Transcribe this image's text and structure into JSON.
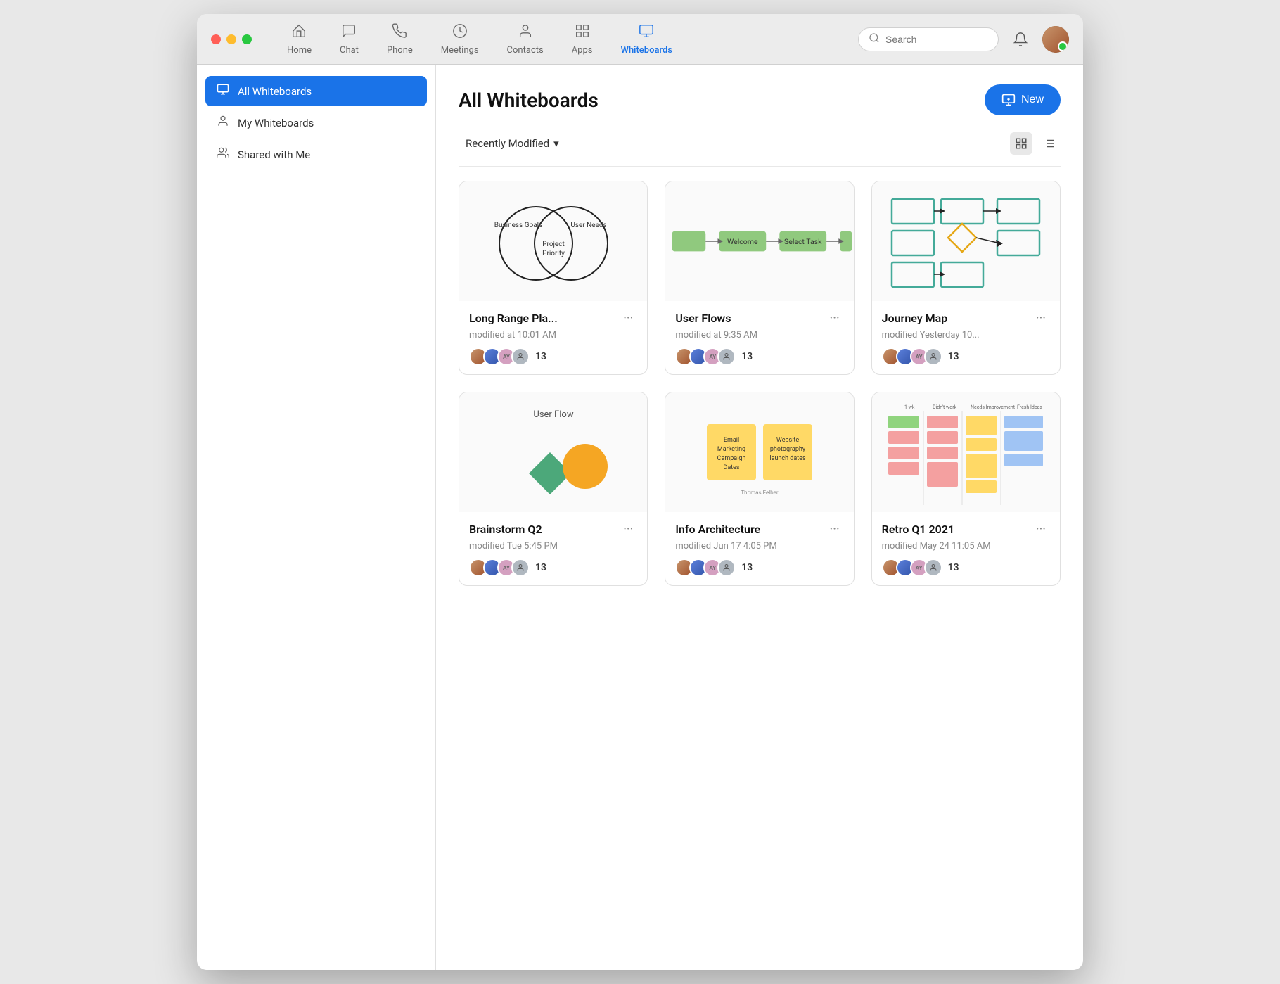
{
  "window": {
    "title": "Whiteboards"
  },
  "titlebar": {
    "search_placeholder": "Search"
  },
  "nav": {
    "tabs": [
      {
        "id": "home",
        "label": "Home",
        "icon": "⌂",
        "active": false
      },
      {
        "id": "chat",
        "label": "Chat",
        "icon": "💬",
        "active": false
      },
      {
        "id": "phone",
        "label": "Phone",
        "icon": "📞",
        "active": false
      },
      {
        "id": "meetings",
        "label": "Meetings",
        "icon": "🕐",
        "active": false
      },
      {
        "id": "contacts",
        "label": "Contacts",
        "icon": "👤",
        "active": false
      },
      {
        "id": "apps",
        "label": "Apps",
        "icon": "⊞",
        "active": false
      },
      {
        "id": "whiteboards",
        "label": "Whiteboards",
        "icon": "🖥",
        "active": true
      }
    ]
  },
  "sidebar": {
    "items": [
      {
        "id": "all",
        "label": "All Whiteboards",
        "icon": "🖥",
        "active": true
      },
      {
        "id": "my",
        "label": "My Whiteboards",
        "icon": "👤",
        "active": false
      },
      {
        "id": "shared",
        "label": "Shared with Me",
        "icon": "👥",
        "active": false
      }
    ]
  },
  "content": {
    "title": "All Whiteboards",
    "new_button": "New",
    "sort": {
      "label": "Recently Modified",
      "chevron": "▾"
    },
    "whiteboards": [
      {
        "id": "wb1",
        "title": "Long Range Pla...",
        "modified": "modified at 10:01 AM",
        "collaborator_count": "13",
        "thumbnail_type": "venn"
      },
      {
        "id": "wb2",
        "title": "User Flows",
        "modified": "modified at 9:35 AM",
        "collaborator_count": "13",
        "thumbnail_type": "flow"
      },
      {
        "id": "wb3",
        "title": "Journey Map",
        "modified": "modified Yesterday 10...",
        "collaborator_count": "13",
        "thumbnail_type": "journey"
      },
      {
        "id": "wb4",
        "title": "Brainstorm Q2",
        "modified": "modified Tue 5:45 PM",
        "collaborator_count": "13",
        "thumbnail_type": "brainstorm"
      },
      {
        "id": "wb5",
        "title": "Info Architecture",
        "modified": "modified Jun 17 4:05 PM",
        "collaborator_count": "13",
        "thumbnail_type": "info"
      },
      {
        "id": "wb6",
        "title": "Retro Q1 2021",
        "modified": "modified May 24 11:05 AM",
        "collaborator_count": "13",
        "thumbnail_type": "retro"
      }
    ]
  }
}
